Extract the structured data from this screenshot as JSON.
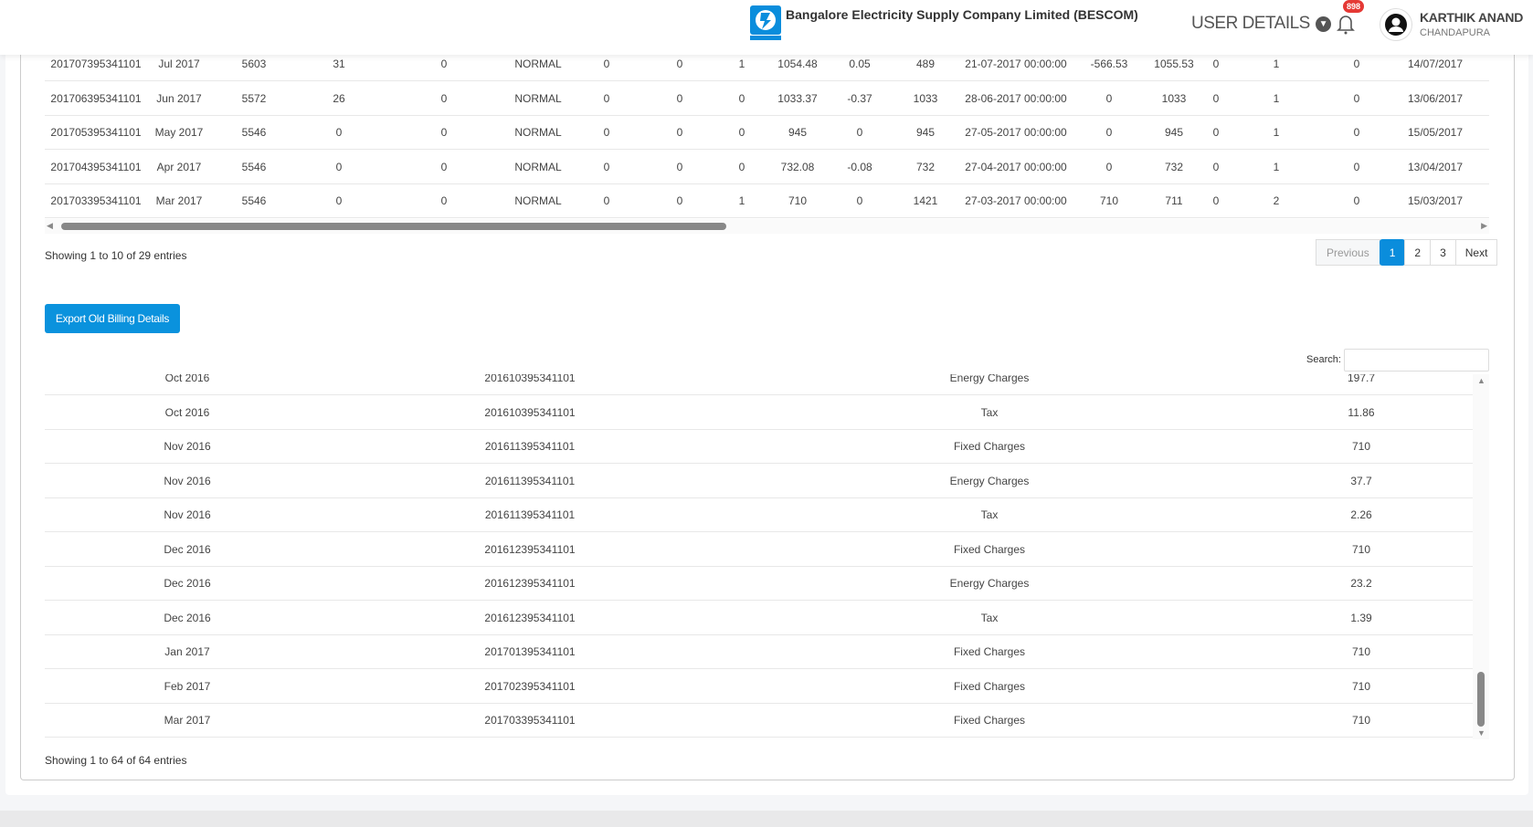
{
  "header": {
    "company": "Bangalore Electricity Supply Company Limited (BESCOM)",
    "logo_text": "BESCOM",
    "user_details": "USER DETAILS",
    "notification_count": "898",
    "user_name": "KARTHIK ANAND",
    "user_location": "CHANDAPURA"
  },
  "billing_table": {
    "rows": [
      [
        "201707395341101",
        "Jul 2017",
        "5603",
        "31",
        "0",
        "NORMAL",
        "0",
        "0",
        "1",
        "1054.48",
        "0.05",
        "489",
        "21-07-2017 00:00:00",
        "-566.53",
        "1055.53",
        "0",
        "1",
        "0",
        "14/07/2017"
      ],
      [
        "201706395341101",
        "Jun 2017",
        "5572",
        "26",
        "0",
        "NORMAL",
        "0",
        "0",
        "0",
        "1033.37",
        "-0.37",
        "1033",
        "28-06-2017 00:00:00",
        "0",
        "1033",
        "0",
        "1",
        "0",
        "13/06/2017"
      ],
      [
        "201705395341101",
        "May 2017",
        "5546",
        "0",
        "0",
        "NORMAL",
        "0",
        "0",
        "0",
        "945",
        "0",
        "945",
        "27-05-2017 00:00:00",
        "0",
        "945",
        "0",
        "1",
        "0",
        "15/05/2017"
      ],
      [
        "201704395341101",
        "Apr 2017",
        "5546",
        "0",
        "0",
        "NORMAL",
        "0",
        "0",
        "0",
        "732.08",
        "-0.08",
        "732",
        "27-04-2017 00:00:00",
        "0",
        "732",
        "0",
        "1",
        "0",
        "13/04/2017"
      ],
      [
        "201703395341101",
        "Mar 2017",
        "5546",
        "0",
        "0",
        "NORMAL",
        "0",
        "0",
        "1",
        "710",
        "0",
        "1421",
        "27-03-2017 00:00:00",
        "710",
        "711",
        "0",
        "2",
        "0",
        "15/03/2017"
      ]
    ],
    "info": "Showing 1 to 10 of 29 entries",
    "pagination": {
      "previous": "Previous",
      "pages": [
        "1",
        "2",
        "3"
      ],
      "next": "Next"
    }
  },
  "export_button": "Export Old Billing Details",
  "charges_table": {
    "search_label": "Search:",
    "search_value": "",
    "rows": [
      [
        "Oct 2016",
        "201610395341101",
        "Energy Charges",
        "197.7"
      ],
      [
        "Oct 2016",
        "201610395341101",
        "Tax",
        "11.86"
      ],
      [
        "Nov 2016",
        "201611395341101",
        "Fixed Charges",
        "710"
      ],
      [
        "Nov 2016",
        "201611395341101",
        "Energy Charges",
        "37.7"
      ],
      [
        "Nov 2016",
        "201611395341101",
        "Tax",
        "2.26"
      ],
      [
        "Dec 2016",
        "201612395341101",
        "Fixed Charges",
        "710"
      ],
      [
        "Dec 2016",
        "201612395341101",
        "Energy Charges",
        "23.2"
      ],
      [
        "Dec 2016",
        "201612395341101",
        "Tax",
        "1.39"
      ],
      [
        "Jan 2017",
        "201701395341101",
        "Fixed Charges",
        "710"
      ],
      [
        "Feb 2017",
        "201702395341101",
        "Fixed Charges",
        "710"
      ],
      [
        "Mar 2017",
        "201703395341101",
        "Fixed Charges",
        "710"
      ]
    ],
    "info": "Showing 1 to 64 of 64 entries"
  }
}
